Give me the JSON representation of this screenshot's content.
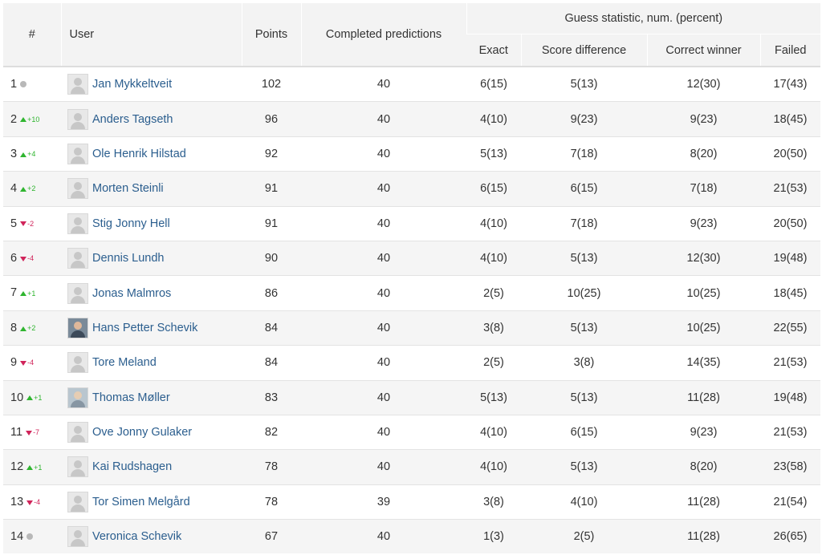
{
  "headers": {
    "rank": "#",
    "user": "User",
    "points": "Points",
    "completed": "Completed predictions",
    "guess_group": "Guess statistic, num. (percent)",
    "exact": "Exact",
    "score_diff": "Score difference",
    "correct_winner": "Correct winner",
    "failed": "Failed"
  },
  "colors": {
    "up": "#2fb52f",
    "down": "#d0245a",
    "link": "#2b5e8e"
  },
  "rows": [
    {
      "rank": "1",
      "trend": "same",
      "change": "",
      "user": "Jan Mykkeltveit",
      "avatar": "default",
      "points": "102",
      "completed": "40",
      "exact": "6(15)",
      "score_diff": "5(13)",
      "correct_winner": "12(30)",
      "failed": "17(43)"
    },
    {
      "rank": "2",
      "trend": "up",
      "change": "+10",
      "user": "Anders Tagseth",
      "avatar": "default",
      "points": "96",
      "completed": "40",
      "exact": "4(10)",
      "score_diff": "9(23)",
      "correct_winner": "9(23)",
      "failed": "18(45)"
    },
    {
      "rank": "3",
      "trend": "up",
      "change": "+4",
      "user": "Ole Henrik Hilstad",
      "avatar": "default",
      "points": "92",
      "completed": "40",
      "exact": "5(13)",
      "score_diff": "7(18)",
      "correct_winner": "8(20)",
      "failed": "20(50)"
    },
    {
      "rank": "4",
      "trend": "up",
      "change": "+2",
      "user": "Morten Steinli",
      "avatar": "default",
      "points": "91",
      "completed": "40",
      "exact": "6(15)",
      "score_diff": "6(15)",
      "correct_winner": "7(18)",
      "failed": "21(53)"
    },
    {
      "rank": "5",
      "trend": "down",
      "change": "-2",
      "user": "Stig Jonny Hell",
      "avatar": "default",
      "points": "91",
      "completed": "40",
      "exact": "4(10)",
      "score_diff": "7(18)",
      "correct_winner": "9(23)",
      "failed": "20(50)"
    },
    {
      "rank": "6",
      "trend": "down",
      "change": "-4",
      "user": "Dennis Lundh",
      "avatar": "default",
      "points": "90",
      "completed": "40",
      "exact": "4(10)",
      "score_diff": "5(13)",
      "correct_winner": "12(30)",
      "failed": "19(48)"
    },
    {
      "rank": "7",
      "trend": "up",
      "change": "+1",
      "user": "Jonas Malmros",
      "avatar": "default",
      "points": "86",
      "completed": "40",
      "exact": "2(5)",
      "score_diff": "10(25)",
      "correct_winner": "10(25)",
      "failed": "18(45)"
    },
    {
      "rank": "8",
      "trend": "up",
      "change": "+2",
      "user": "Hans Petter Schevik",
      "avatar": "photo",
      "points": "84",
      "completed": "40",
      "exact": "3(8)",
      "score_diff": "5(13)",
      "correct_winner": "10(25)",
      "failed": "22(55)"
    },
    {
      "rank": "9",
      "trend": "down",
      "change": "-4",
      "user": "Tore Meland",
      "avatar": "default",
      "points": "84",
      "completed": "40",
      "exact": "2(5)",
      "score_diff": "3(8)",
      "correct_winner": "14(35)",
      "failed": "21(53)"
    },
    {
      "rank": "10",
      "trend": "up",
      "change": "+1",
      "user": "Thomas Møller",
      "avatar": "photo2",
      "points": "83",
      "completed": "40",
      "exact": "5(13)",
      "score_diff": "5(13)",
      "correct_winner": "11(28)",
      "failed": "19(48)"
    },
    {
      "rank": "11",
      "trend": "down",
      "change": "-7",
      "user": "Ove Jonny Gulaker",
      "avatar": "default",
      "points": "82",
      "completed": "40",
      "exact": "4(10)",
      "score_diff": "6(15)",
      "correct_winner": "9(23)",
      "failed": "21(53)"
    },
    {
      "rank": "12",
      "trend": "up",
      "change": "+1",
      "user": "Kai Rudshagen",
      "avatar": "default",
      "points": "78",
      "completed": "40",
      "exact": "4(10)",
      "score_diff": "5(13)",
      "correct_winner": "8(20)",
      "failed": "23(58)"
    },
    {
      "rank": "13",
      "trend": "down",
      "change": "-4",
      "user": "Tor Simen Melgård",
      "avatar": "default",
      "points": "78",
      "completed": "39",
      "exact": "3(8)",
      "score_diff": "4(10)",
      "correct_winner": "11(28)",
      "failed": "21(54)"
    },
    {
      "rank": "14",
      "trend": "same",
      "change": "",
      "user": "Veronica Schevik",
      "avatar": "default",
      "points": "67",
      "completed": "40",
      "exact": "1(3)",
      "score_diff": "2(5)",
      "correct_winner": "11(28)",
      "failed": "26(65)"
    }
  ]
}
